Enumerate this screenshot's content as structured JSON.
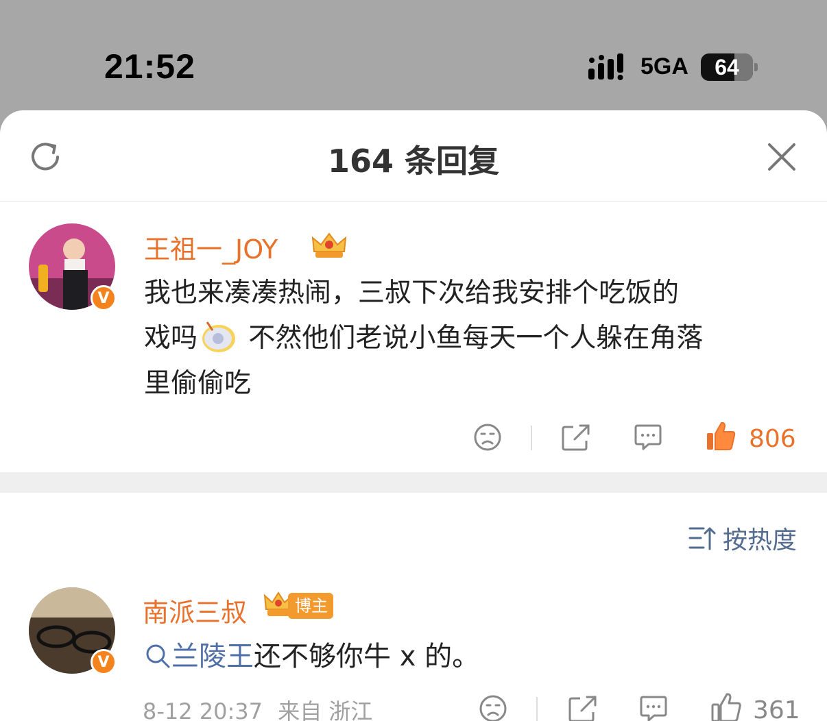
{
  "status_bar": {
    "time": "21:52",
    "network": "5GA",
    "battery": "64",
    "battery_level_percent": 64
  },
  "sheet": {
    "title": "164 条回复"
  },
  "main_comment": {
    "username": "王祖一_JOY",
    "text_lines": [
      "我也来凑凑热闹，三叔下次给我安排个吃饭的",
      "戏吗",
      " 不然他们老说小鱼每天一个人躲在角落",
      "里偷偷吃"
    ],
    "like_count": "806",
    "liked": true
  },
  "sort": {
    "label": "按热度"
  },
  "reply": {
    "username": "南派三叔",
    "badge": "博主",
    "mention": "兰陵王",
    "text": "还不够你牛 x 的。",
    "time": "8-12 20:37",
    "source": "来自 浙江",
    "like_count": "361"
  },
  "colors": {
    "accent": "#e8722c",
    "link": "#4f6fa8",
    "badge": "#f39a2f"
  }
}
